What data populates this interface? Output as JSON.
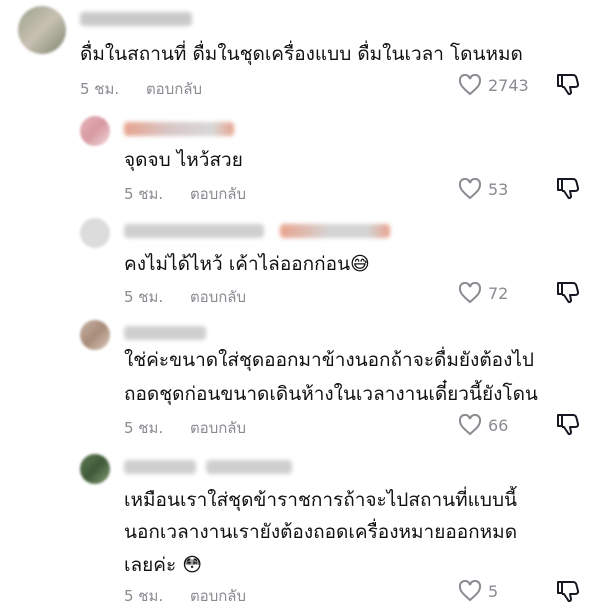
{
  "comments": [
    {
      "text_lines": [
        "ดื่มในสถานที่ ดื่มในชุดเครื่องแบบ ดื่มในเวลา โดนหมด"
      ],
      "time": "5 ชม.",
      "reply_label": "ตอบกลับ",
      "likes": "2743"
    },
    {
      "text_lines": [
        "จุดจบ ไหว้สวย"
      ],
      "time": "5 ชม.",
      "reply_label": "ตอบกลับ",
      "likes": "53"
    },
    {
      "text_lines": [
        "คงไม่ได้ไหว้ เค้าไล่ออกก่อน😅"
      ],
      "time": "5 ชม.",
      "reply_label": "ตอบกลับ",
      "likes": "72"
    },
    {
      "text_lines": [
        "ใช่ค่ะขนาดใส่ชุดออกมาข้างนอกถ้าจะดื่มยังต้องไป",
        "ถอดชุดก่อนขนาดเดินห้างในเวลางานเดี๋ยวนี้ยังโดน"
      ],
      "time": "5 ชม.",
      "reply_label": "ตอบกลับ",
      "likes": "66"
    },
    {
      "text_lines": [
        "เหมือนเราใส่ชุดข้าราชการถ้าจะไปสถานที่แบบนี้",
        "นอกเวลางานเรายังต้องถอดเครื่องหมายออกหมด",
        "เลยค่ะ 😳"
      ],
      "time": "5 ชม.",
      "reply_label": "ตอบกลับ",
      "likes": "5"
    }
  ],
  "icons": {
    "like": "heart-outline-icon",
    "dislike": "thumbs-down-outline-icon"
  },
  "colors": {
    "meta_gray": "#8a8b91",
    "text": "#111111"
  }
}
